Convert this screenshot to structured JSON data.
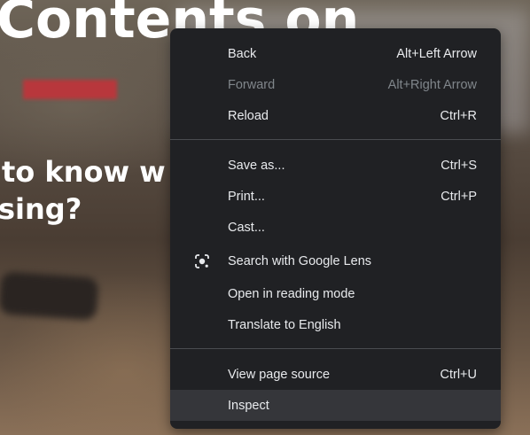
{
  "page": {
    "headline": "Contents on",
    "subline1": "to know w",
    "subline2": "sing?"
  },
  "menu": {
    "items": [
      {
        "label": "Back",
        "shortcut": "Alt+Left Arrow",
        "enabled": true
      },
      {
        "label": "Forward",
        "shortcut": "Alt+Right Arrow",
        "enabled": false
      },
      {
        "label": "Reload",
        "shortcut": "Ctrl+R",
        "enabled": true
      },
      {
        "label": "Save as...",
        "shortcut": "Ctrl+S",
        "enabled": true
      },
      {
        "label": "Print...",
        "shortcut": "Ctrl+P",
        "enabled": true
      },
      {
        "label": "Cast...",
        "shortcut": "",
        "enabled": true
      },
      {
        "label": "Search with Google Lens",
        "shortcut": "",
        "enabled": true,
        "icon": "google-lens-icon"
      },
      {
        "label": "Open in reading mode",
        "shortcut": "",
        "enabled": true
      },
      {
        "label": "Translate to English",
        "shortcut": "",
        "enabled": true
      },
      {
        "label": "View page source",
        "shortcut": "Ctrl+U",
        "enabled": true
      },
      {
        "label": "Inspect",
        "shortcut": "",
        "enabled": true,
        "highlighted": true
      }
    ]
  },
  "colors": {
    "menu_bg": "#202124",
    "text": "#e8eaed",
    "disabled_text": "#80868b",
    "highlight": "#35363a",
    "separator": "#4a4c50"
  }
}
